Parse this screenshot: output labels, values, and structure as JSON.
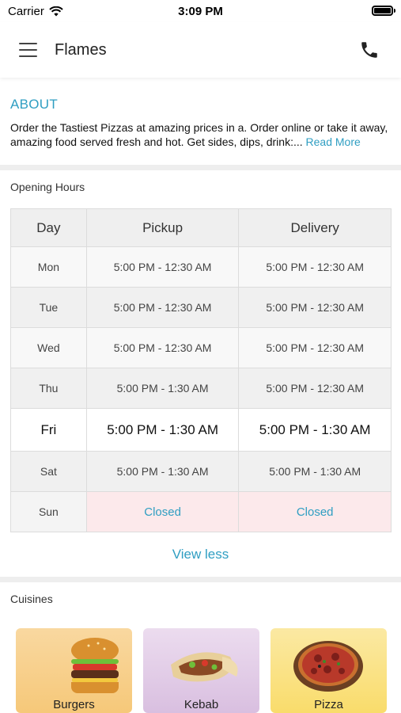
{
  "status_bar": {
    "carrier": "Carrier",
    "time": "3:09 PM"
  },
  "header": {
    "title": "Flames",
    "menu_icon": "hamburger-menu-icon",
    "phone_icon": "phone-icon"
  },
  "about": {
    "title": "ABOUT",
    "text": "Order the Tastiest Pizzas at amazing prices in a. Order online or take it away, amazing food served fresh and hot. Get sides, dips, drink:...",
    "read_more": "Read More"
  },
  "opening_hours": {
    "title": "Opening Hours",
    "headers": {
      "day": "Day",
      "pickup": "Pickup",
      "delivery": "Delivery"
    },
    "rows": [
      {
        "day": "Mon",
        "pickup": "5:00 PM - 12:30 AM",
        "delivery": "5:00 PM - 12:30 AM"
      },
      {
        "day": "Tue",
        "pickup": "5:00 PM - 12:30 AM",
        "delivery": "5:00 PM - 12:30 AM"
      },
      {
        "day": "Wed",
        "pickup": "5:00 PM - 12:30 AM",
        "delivery": "5:00 PM - 12:30 AM"
      },
      {
        "day": "Thu",
        "pickup": "5:00 PM - 1:30 AM",
        "delivery": "5:00 PM - 12:30 AM"
      },
      {
        "day": "Fri",
        "pickup": "5:00 PM - 1:30 AM",
        "delivery": "5:00 PM - 1:30 AM"
      },
      {
        "day": "Sat",
        "pickup": "5:00 PM - 1:30 AM",
        "delivery": "5:00 PM - 1:30 AM"
      },
      {
        "day": "Sun",
        "pickup": "Closed",
        "delivery": "Closed"
      }
    ],
    "toggle_label": "View less"
  },
  "cuisines": {
    "title": "Cuisines",
    "items": [
      {
        "label": "Burgers"
      },
      {
        "label": "Kebab"
      },
      {
        "label": "Pizza"
      }
    ]
  },
  "colors": {
    "accent": "#2f9ec2",
    "closed_bg": "#fce9eb"
  }
}
